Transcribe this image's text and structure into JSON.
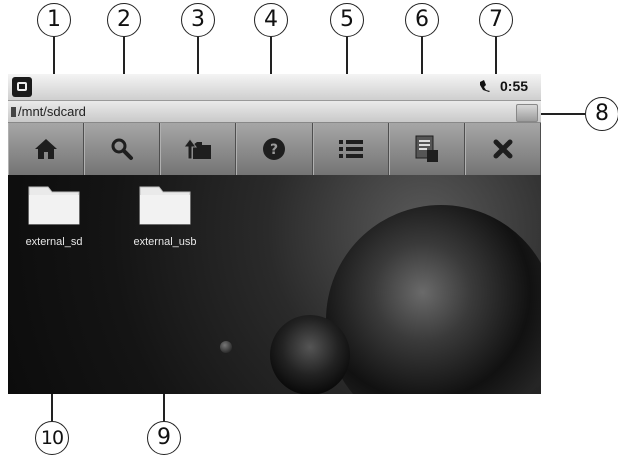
{
  "callouts": [
    "1",
    "2",
    "3",
    "4",
    "5",
    "6",
    "7",
    "8",
    "9",
    "10"
  ],
  "status_bar": {
    "app_icon": "notification-app-icon",
    "signal_icon": "phone-signal-icon",
    "time": "0:55"
  },
  "path_bar": {
    "path": "/mnt/sdcard",
    "toggle_icon": "path-toggle-icon"
  },
  "toolbar": {
    "buttons": [
      {
        "name": "home",
        "icon": "home-icon"
      },
      {
        "name": "search",
        "icon": "search-icon"
      },
      {
        "name": "up-folder",
        "icon": "folder-up-icon"
      },
      {
        "name": "help",
        "icon": "help-icon"
      },
      {
        "name": "list-view",
        "icon": "list-icon"
      },
      {
        "name": "clipboard",
        "icon": "clipboard-icon"
      },
      {
        "name": "close",
        "icon": "close-icon"
      }
    ]
  },
  "files": [
    {
      "label": "external_sd",
      "icon": "folder-icon"
    },
    {
      "label": "external_usb",
      "icon": "folder-icon"
    }
  ],
  "colors": {
    "toolbar": "#888888",
    "desktop": "#1a1a1a",
    "folder": "#e8e8e8"
  }
}
